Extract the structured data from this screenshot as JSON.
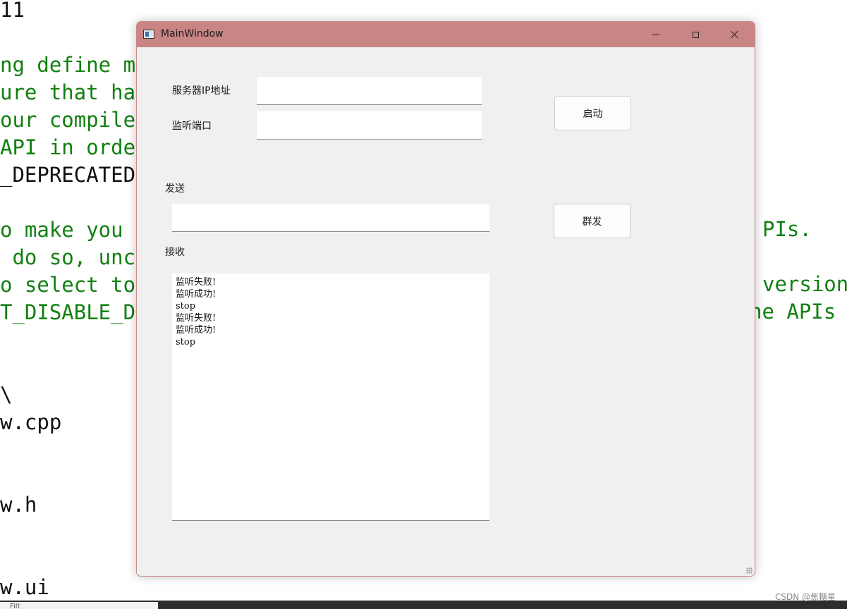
{
  "editor": {
    "lines": [
      {
        "text": "11",
        "color": "#111111"
      },
      {
        "text": "",
        "color": "#108010"
      },
      {
        "text": "ng define m",
        "color": "#108010"
      },
      {
        "text": "ure that ha",
        "color": "#108010"
      },
      {
        "text": "our compile",
        "color": "#108010"
      },
      {
        "text": "API in orde",
        "color": "#108010"
      },
      {
        "text": "_DEPRECATED",
        "color": "#111111"
      },
      {
        "text": "",
        "color": "#108010"
      },
      {
        "text": "o make you",
        "color": "#108010"
      },
      {
        "text": " do so, unc",
        "color": "#108010"
      },
      {
        "text": "o select to",
        "color": "#108010"
      },
      {
        "text": "T_DISABLE_D",
        "color": "#108010"
      },
      {
        "text": "",
        "color": "#108010"
      },
      {
        "text": "",
        "color": "#108010"
      },
      {
        "text": "\\",
        "color": "#111111"
      },
      {
        "text": "w.cpp",
        "color": "#111111"
      },
      {
        "text": "",
        "color": "#111111"
      },
      {
        "text": "",
        "color": "#111111"
      },
      {
        "text": "w.h",
        "color": "#111111"
      },
      {
        "text": "",
        "color": "#111111"
      },
      {
        "text": "",
        "color": "#111111"
      },
      {
        "text": "w.ui",
        "color": "#111111"
      }
    ],
    "right_fragments": [
      "PIs.",
      "version",
      "he APIs"
    ]
  },
  "filter_text": "Filt",
  "watermark": "CSDN @焦糖星",
  "window": {
    "title": "MainWindow",
    "server_ip_label": "服务器IP地址",
    "server_ip_value": "",
    "port_label": "监听端口",
    "port_value": "",
    "start_button": "启动",
    "send_label": "发送",
    "send_value": "",
    "broadcast_button": "群发",
    "receive_label": "接收",
    "receive_lines": [
      "监听失败!",
      "监听成功!",
      "stop",
      "监听失败!",
      "监听成功!",
      "stop"
    ]
  },
  "colors": {
    "titlebar": "#c98584",
    "window_bg": "#f0f0f0",
    "code_green": "#108010"
  },
  "icons": {
    "app": "app-window-icon",
    "minimize": "minimize-icon",
    "maximize": "maximize-icon",
    "close": "close-icon"
  }
}
